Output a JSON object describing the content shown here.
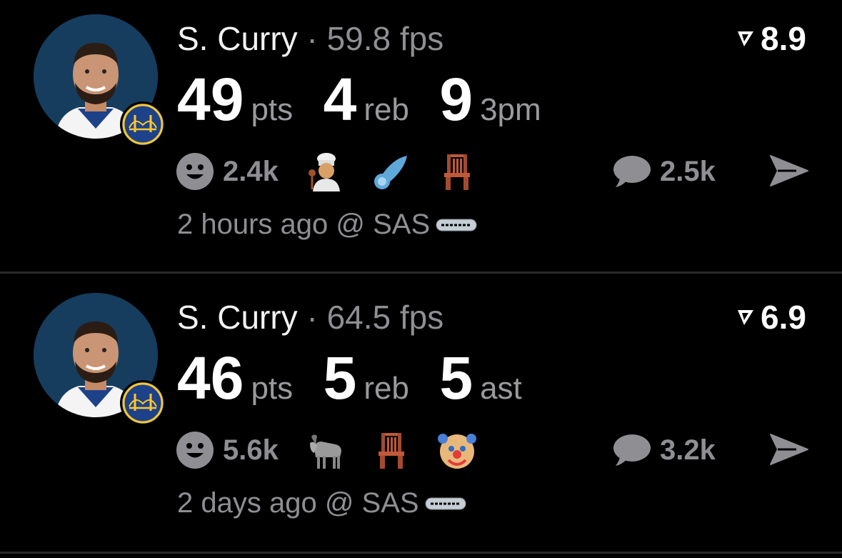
{
  "posts": [
    {
      "player": "S. Curry",
      "separator": "·",
      "fps": "59.8 fps",
      "rating": "8.9",
      "stats": [
        {
          "value": "49",
          "unit": "pts"
        },
        {
          "value": "4",
          "unit": "reb"
        },
        {
          "value": "9",
          "unit": "3pm"
        }
      ],
      "reaction_count": "2.4k",
      "reaction_emojis": [
        "chef-emoji",
        "comet-emoji",
        "chair-emoji"
      ],
      "comment_count": "2.5k",
      "time": "2 hours ago @ SAS"
    },
    {
      "player": "S. Curry",
      "separator": "·",
      "fps": "64.5 fps",
      "rating": "6.9",
      "stats": [
        {
          "value": "46",
          "unit": "pts"
        },
        {
          "value": "5",
          "unit": "reb"
        },
        {
          "value": "5",
          "unit": "ast"
        }
      ],
      "reaction_count": "5.6k",
      "reaction_emojis": [
        "goat-emoji",
        "chair-emoji",
        "clown-emoji"
      ],
      "comment_count": "3.2k",
      "time": "2 days ago @ SAS"
    }
  ],
  "colors": {
    "background": "#000000",
    "primary_text": "#ffffff",
    "secondary_text": "#8e8e93",
    "divider": "#2a2a2c",
    "warriors_blue": "#1d428a",
    "warriors_gold": "#ffc72c"
  }
}
